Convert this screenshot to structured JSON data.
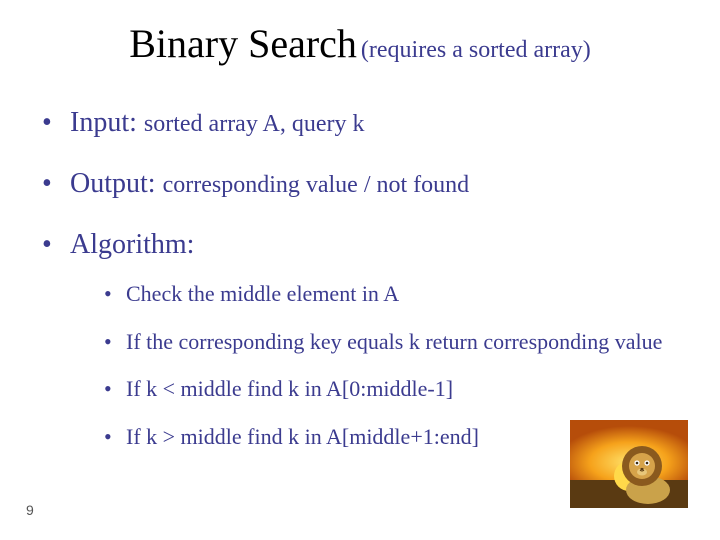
{
  "title": {
    "main": "Binary Search",
    "sub": "(requires a sorted array)"
  },
  "bullets": [
    {
      "lead": "Input:",
      "rest": "sorted array A, query k"
    },
    {
      "lead": "Output:",
      "rest": "corresponding value / not found"
    },
    {
      "lead": "Algorithm:",
      "rest": "",
      "sub": [
        "Check the middle element in A",
        "If the corresponding key equals k return corresponding value",
        "If k < middle find k in A[0:middle-1]",
        "If k > middle find k in A[middle+1:end]"
      ]
    }
  ],
  "page_number": "9",
  "illustration": "cartoon-lion-sunset"
}
